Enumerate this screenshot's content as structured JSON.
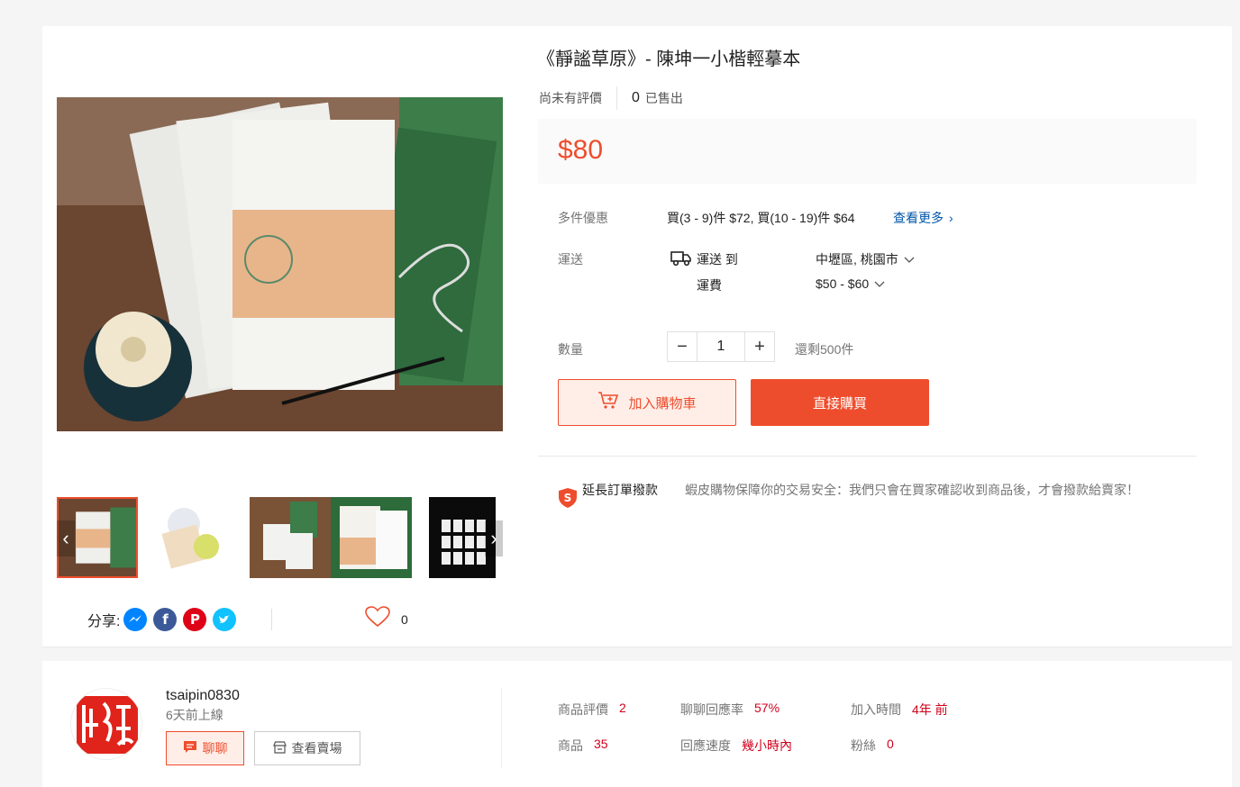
{
  "product": {
    "title": "《靜謐草原》- 陳坤一小楷輕摹本",
    "rating_text": "尚未有評價",
    "sold_count": "0",
    "sold_label": "已售出",
    "price": "$80"
  },
  "details": {
    "bulk_label": "多件優惠",
    "bulk_value": "買(3 - 9)件 $72, 買(10 - 19)件 $64",
    "bulk_more": "查看更多",
    "shipping_label": "運送",
    "ship_to_label": "運送 到",
    "ship_to_value": "中壢區, 桃園市",
    "ship_fee_label": "運費",
    "ship_fee_value": "$50 - $60",
    "quantity_label": "數量",
    "quantity_value": "1",
    "stock_text": "還剩500件"
  },
  "actions": {
    "add_cart": "加入購物車",
    "buy_now": "直接購買"
  },
  "guarantee": {
    "title": "延長訂單撥款",
    "text": "蝦皮購物保障你的交易安全：我們只會在買家確認收到商品後，才會撥款給賣家！"
  },
  "share": {
    "label": "分享:",
    "likes": "0"
  },
  "seller": {
    "name": "tsaipin0830",
    "online": "6天前上線",
    "chat": "聊聊",
    "view_shop": "查看賣場",
    "stats": [
      {
        "label": "商品評價",
        "value": "2"
      },
      {
        "label": "聊聊回應率",
        "value": "57%"
      },
      {
        "label": "加入時間",
        "value": "4年 前"
      },
      {
        "label": "商品",
        "value": "35"
      },
      {
        "label": "回應速度",
        "value": "幾小時內"
      },
      {
        "label": "粉絲",
        "value": "0"
      }
    ]
  },
  "colors": {
    "accent": "#ee4d2d",
    "link": "#0055aa"
  }
}
